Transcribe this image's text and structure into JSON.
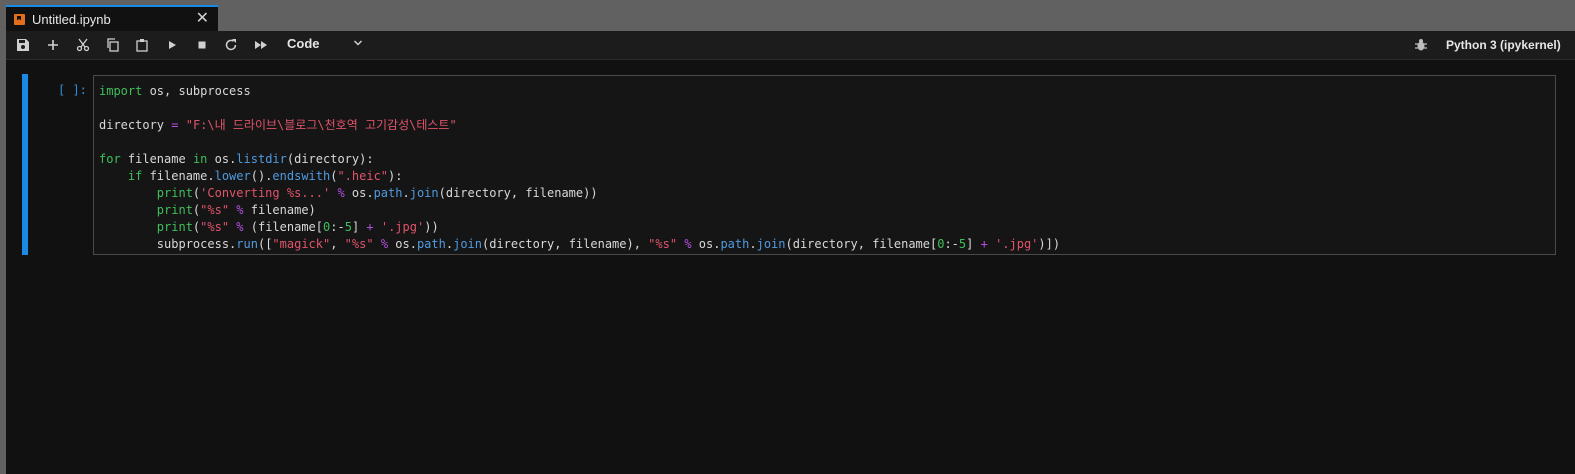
{
  "tab": {
    "title": "Untitled.ipynb",
    "close_glyph": "✕"
  },
  "toolbar": {
    "buttons": [
      "save-icon",
      "add-icon",
      "cut-icon",
      "copy-icon",
      "paste-icon",
      "run-icon",
      "stop-icon",
      "restart-icon",
      "run-all-icon"
    ],
    "cell_type": "Code",
    "kernel_name": "Python 3 (ipykernel)"
  },
  "cell": {
    "prompt": "[ ]:",
    "lines": [
      [
        [
          "kw",
          "import"
        ],
        [
          "t",
          " os, subprocess"
        ]
      ],
      [],
      [
        [
          "t",
          "directory "
        ],
        [
          "op",
          "="
        ],
        [
          "t",
          " "
        ],
        [
          "str",
          "\"F:\\내 드라이브\\블로그\\천호역 고기감성\\테스트\""
        ]
      ],
      [],
      [
        [
          "kw",
          "for"
        ],
        [
          "t",
          " filename "
        ],
        [
          "kw",
          "in"
        ],
        [
          "t",
          " os."
        ],
        [
          "fn",
          "listdir"
        ],
        [
          "t",
          "(directory):"
        ]
      ],
      [
        [
          "t",
          "    "
        ],
        [
          "kw",
          "if"
        ],
        [
          "t",
          " filename."
        ],
        [
          "fn",
          "lower"
        ],
        [
          "t",
          "()."
        ],
        [
          "fn",
          "endswith"
        ],
        [
          "t",
          "("
        ],
        [
          "str",
          "\".heic\""
        ],
        [
          "t",
          "):"
        ]
      ],
      [
        [
          "t",
          "        "
        ],
        [
          "kw",
          "print"
        ],
        [
          "t",
          "("
        ],
        [
          "str",
          "'Converting %s...'"
        ],
        [
          "t",
          " "
        ],
        [
          "op",
          "%"
        ],
        [
          "t",
          " os."
        ],
        [
          "fn",
          "path"
        ],
        [
          "t",
          "."
        ],
        [
          "fn",
          "join"
        ],
        [
          "t",
          "(directory, filename))"
        ]
      ],
      [
        [
          "t",
          "        "
        ],
        [
          "kw",
          "print"
        ],
        [
          "t",
          "("
        ],
        [
          "str",
          "\"%s\""
        ],
        [
          "t",
          " "
        ],
        [
          "op",
          "%"
        ],
        [
          "t",
          " filename)"
        ]
      ],
      [
        [
          "t",
          "        "
        ],
        [
          "kw",
          "print"
        ],
        [
          "t",
          "("
        ],
        [
          "str",
          "\"%s\""
        ],
        [
          "t",
          " "
        ],
        [
          "op",
          "%"
        ],
        [
          "t",
          " (filename["
        ],
        [
          "num",
          "0"
        ],
        [
          "t",
          ":-"
        ],
        [
          "num",
          "5"
        ],
        [
          "t",
          "] "
        ],
        [
          "op",
          "+"
        ],
        [
          "t",
          " "
        ],
        [
          "str",
          "'.jpg'"
        ],
        [
          "t",
          "))"
        ]
      ],
      [
        [
          "t",
          "        subprocess."
        ],
        [
          "fn",
          "run"
        ],
        [
          "t",
          "(["
        ],
        [
          "str",
          "\"magick\""
        ],
        [
          "t",
          ", "
        ],
        [
          "str",
          "\"%s\""
        ],
        [
          "t",
          " "
        ],
        [
          "op",
          "%"
        ],
        [
          "t",
          " os."
        ],
        [
          "fn",
          "path"
        ],
        [
          "t",
          "."
        ],
        [
          "fn",
          "join"
        ],
        [
          "t",
          "(directory, filename), "
        ],
        [
          "str",
          "\"%s\""
        ],
        [
          "t",
          " "
        ],
        [
          "op",
          "%"
        ],
        [
          "t",
          " os."
        ],
        [
          "fn",
          "path"
        ],
        [
          "t",
          "."
        ],
        [
          "fn",
          "join"
        ],
        [
          "t",
          "(directory, filename["
        ],
        [
          "num",
          "0"
        ],
        [
          "t",
          ":-"
        ],
        [
          "num",
          "5"
        ],
        [
          "t",
          "] "
        ],
        [
          "op",
          "+"
        ],
        [
          "t",
          " "
        ],
        [
          "str",
          "'.jpg'"
        ],
        [
          "t",
          ")])"
        ]
      ]
    ]
  },
  "colors": {
    "accent": "#1a8ae6",
    "keyword": "#3fbf5a",
    "function": "#4f9be0",
    "string": "#e0546a",
    "operator": "#b44fe0"
  }
}
